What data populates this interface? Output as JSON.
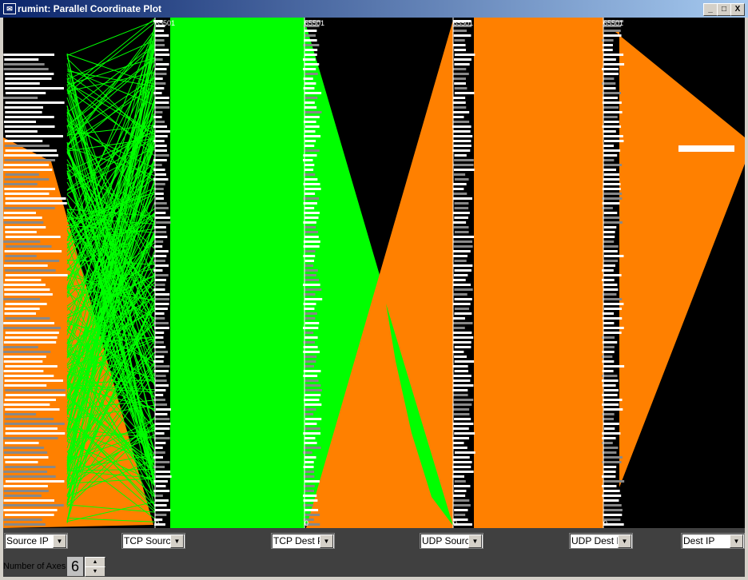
{
  "window": {
    "title": "rumint: Parallel Coordinate Plot",
    "icon": "envelope-icon",
    "buttons": [
      "_",
      "□",
      "X"
    ]
  },
  "colors": {
    "tcp": "#00ff00",
    "udp": "#ff8000",
    "background": "#000000",
    "panel": "#404040"
  },
  "axes": [
    {
      "label": "Source IP"
    },
    {
      "label": "TCP Source",
      "top": "65501",
      "bottom": "0"
    },
    {
      "label": "TCP Dest P",
      "top": "65501",
      "bottom": "0"
    },
    {
      "label": "UDP Sourc",
      "top": "65501",
      "bottom": "0"
    },
    {
      "label": "UDP Dest P",
      "top": "65501",
      "bottom": "0"
    },
    {
      "label": "Dest IP"
    }
  ],
  "controls": {
    "num_axes_label": "Number of Axes",
    "num_axes": "6",
    "up": "▲",
    "down": "▼"
  }
}
